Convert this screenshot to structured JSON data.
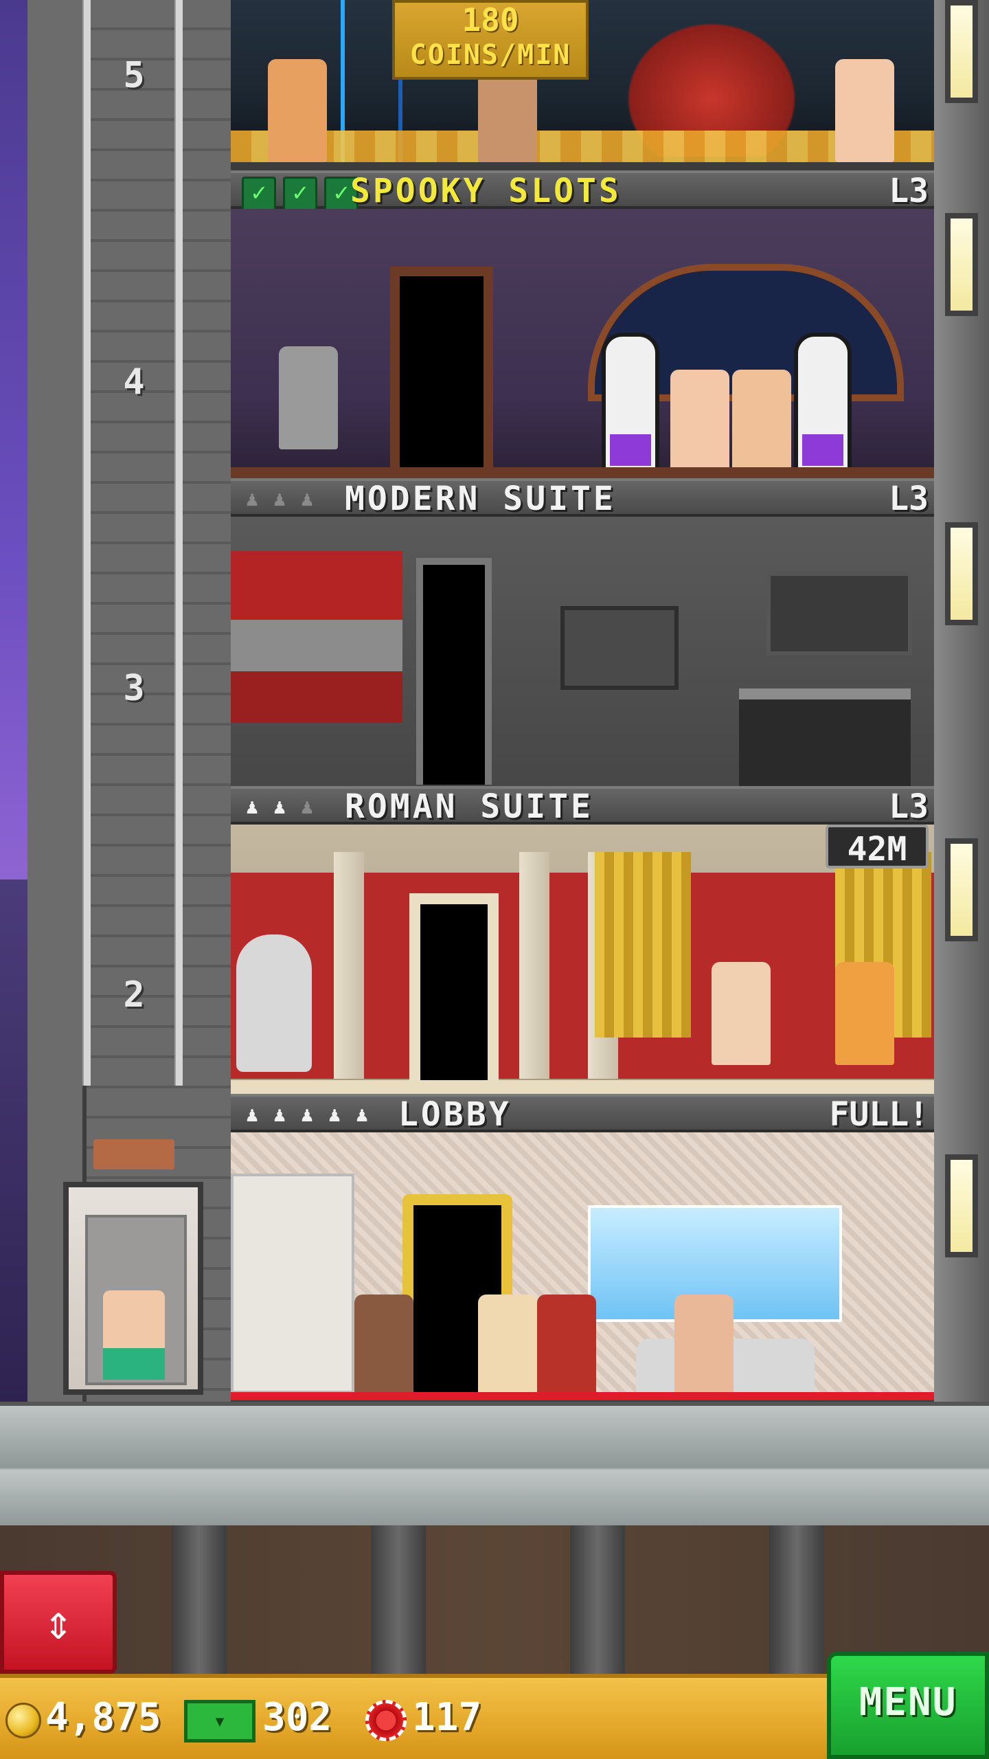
{
  "colors": {
    "menu_green": "#1fc83a",
    "elevator_red": "#e02030",
    "gold_bar": "#e8ad2e",
    "spooky_title_yellow": "#f3e93a"
  },
  "elevator_shaft": {
    "floor_numbers": [
      "5",
      "4",
      "3",
      "2"
    ],
    "rider_present": true
  },
  "floors": [
    {
      "id": "top-floor",
      "coin_badge": {
        "value": "180",
        "unit": "COINS/MIN"
      }
    },
    {
      "id": "spooky-slots",
      "name": "SPOOKY SLOTS",
      "level": "L3",
      "stock_checks": 3,
      "icons": [
        "check-icon",
        "check-icon",
        "check-icon"
      ]
    },
    {
      "id": "modern-suite",
      "name": "MODERN SUITE",
      "level": "L3",
      "occupancy": {
        "filled": 0,
        "total": 3
      }
    },
    {
      "id": "roman-suite",
      "name": "ROMAN SUITE",
      "level": "L3",
      "occupancy": {
        "filled": 2,
        "total": 3
      },
      "timer": "42M"
    },
    {
      "id": "lobby",
      "name": "LOBBY",
      "status": "FULL!",
      "occupancy": {
        "filled": 5,
        "total": 5
      }
    }
  ],
  "bottom_bar": {
    "coins": "4,875",
    "tower_bux": "302",
    "casino_chips": "117",
    "menu_label": "MENU",
    "icons": [
      "coin-icon",
      "bux-icon",
      "chip-icon",
      "elevator-updown-icon"
    ]
  }
}
